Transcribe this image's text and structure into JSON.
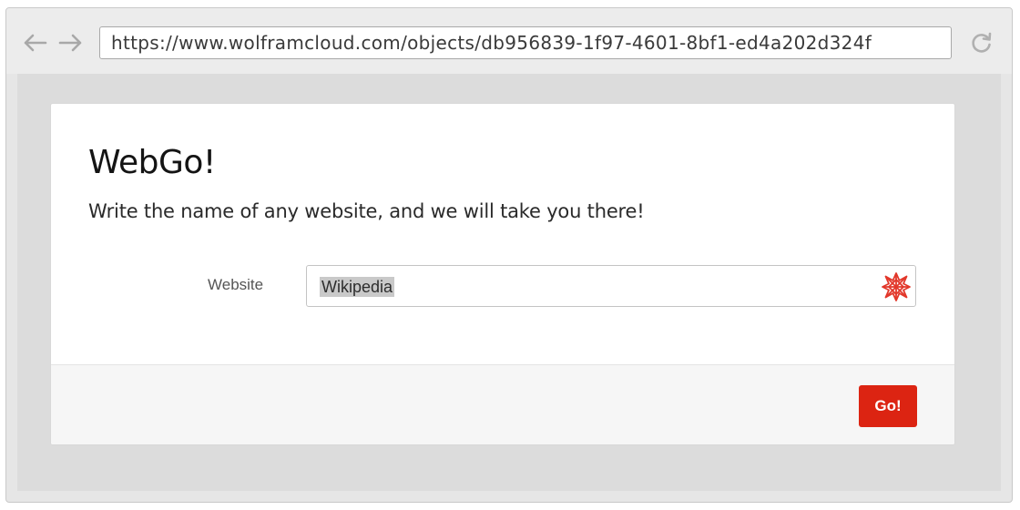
{
  "browser": {
    "url": "https://www.wolframcloud.com/objects/db956839-1f97-4601-8bf1-ed4a202d324f",
    "back_icon": "arrow-left-icon",
    "forward_icon": "arrow-right-icon",
    "reload_icon": "reload-icon"
  },
  "form": {
    "title": "WebGo!",
    "subtitle": "Write the name of any website, and we will take you there!",
    "field_label": "Website",
    "field_value": "Wikipedia",
    "field_icon": "wolfram-spikey-icon",
    "submit_label": "Go!"
  },
  "colors": {
    "accent": "#dc2412",
    "window_bg": "#e6e6e6",
    "card_bg": "#ffffff",
    "footer_bg": "#f6f6f6"
  }
}
